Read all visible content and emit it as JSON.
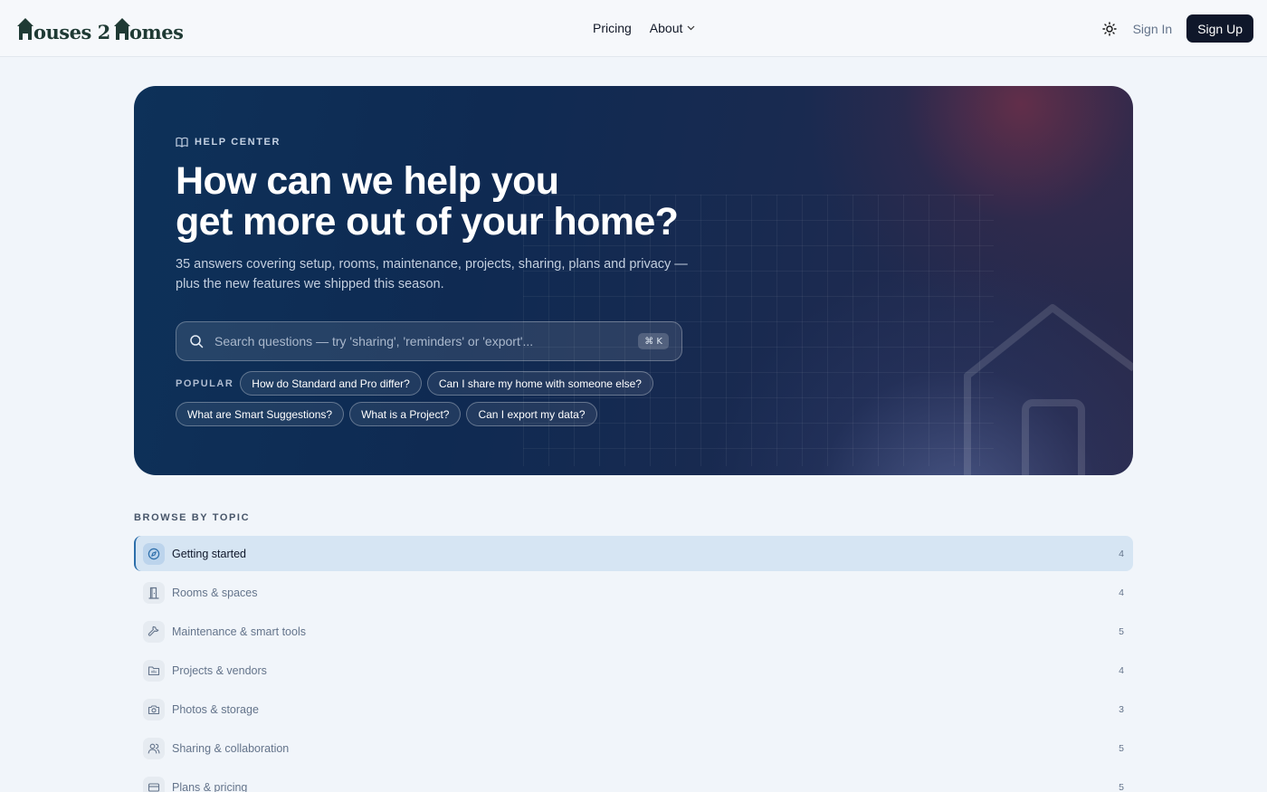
{
  "header": {
    "logo_text": "Houses 2 Homes",
    "nav": {
      "pricing": "Pricing",
      "about": "About"
    },
    "sign_in": "Sign In",
    "sign_up": "Sign Up"
  },
  "hero": {
    "eyebrow": "HELP CENTER",
    "title_line1": "How can we help you",
    "title_line2": "get more out of your home?",
    "subtitle": "35 answers covering setup, rooms, maintenance, projects, sharing, plans and privacy — plus the new features we shipped this season.",
    "search_placeholder": "Search questions — try 'sharing', 'reminders' or 'export'...",
    "shortcut": "⌘ K",
    "popular_label": "POPULAR",
    "popular": [
      "How do Standard and Pro differ?",
      "Can I share my home with someone else?",
      "What are Smart Suggestions?",
      "What is a Project?",
      "Can I export my data?"
    ]
  },
  "topics": {
    "heading": "BROWSE BY TOPIC",
    "items": [
      {
        "label": "Getting started",
        "count": "4",
        "icon": "compass-icon",
        "active": true
      },
      {
        "label": "Rooms & spaces",
        "count": "4",
        "icon": "door-icon"
      },
      {
        "label": "Maintenance & smart tools",
        "count": "5",
        "icon": "wrench-icon"
      },
      {
        "label": "Projects & vendors",
        "count": "4",
        "icon": "folder-icon"
      },
      {
        "label": "Photos & storage",
        "count": "3",
        "icon": "camera-icon"
      },
      {
        "label": "Sharing & collaboration",
        "count": "5",
        "icon": "users-icon"
      },
      {
        "label": "Plans & pricing",
        "count": "5",
        "icon": "credit-card-icon"
      }
    ]
  },
  "colors": {
    "accent": "#2c6eaa",
    "dark": "#0f172a",
    "hero_start": "#0d3159",
    "hero_end": "#2a2a4c"
  }
}
